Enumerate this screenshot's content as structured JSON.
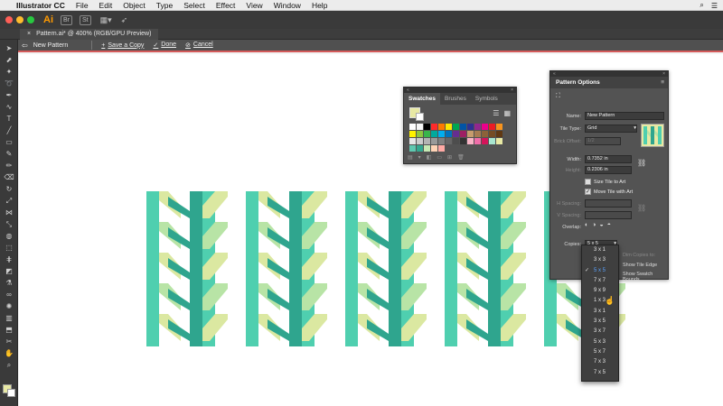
{
  "menubar": {
    "app": "Illustrator CC",
    "items": [
      "File",
      "Edit",
      "Object",
      "Type",
      "Select",
      "Effect",
      "View",
      "Window",
      "Help"
    ]
  },
  "appbar": {
    "logo": "Ai",
    "chips": [
      "Br",
      "St"
    ]
  },
  "document": {
    "tab_title": "Pattern.ai* @ 400% (RGB/GPU Preview)",
    "close": "×"
  },
  "pattern_bar": {
    "name": "New Pattern",
    "save_copy": "Save a Copy",
    "done": "Done",
    "cancel": "Cancel"
  },
  "swatches_panel": {
    "tabs": [
      "Swatches",
      "Brushes",
      "Symbols"
    ],
    "colors": [
      "#ffffff",
      "#f7f7f7",
      "#000000",
      "#ff2a2a",
      "#ff7a00",
      "#ffe600",
      "#00a651",
      "#0054a6",
      "#2e3192",
      "#92278f",
      "#ec008c",
      "#ed1c24",
      "#f7941d",
      "#fff200",
      "#8dc63f",
      "#39b54a",
      "#00a99d",
      "#00aeef",
      "#0072bc",
      "#662d91",
      "#9e1f63",
      "#c69c6d",
      "#a67c52",
      "#8c6239",
      "#754c24",
      "#603913",
      "#e6e6e6",
      "#cccccc",
      "#b3b3b3",
      "#999999",
      "#808080",
      "#666666",
      "#4d4d4d",
      "#333333",
      "#f9b4c6",
      "#f06ea9",
      "#d4145a",
      "#a8e6cf",
      "#e8e9a4",
      "#5ec8b0",
      "#33a88f",
      "#c7e9b4",
      "#ffd3b6",
      "#ffaaa5"
    ]
  },
  "pattern_options": {
    "title": "Pattern Options",
    "name_label": "Name:",
    "name_value": "New Pattern",
    "tile_type_label": "Tile Type:",
    "tile_type_value": "Grid",
    "brick_offset_label": "Brick Offset:",
    "brick_offset_value": "1/2",
    "width_label": "Width:",
    "width_value": "0.7352 in",
    "height_label": "Height:",
    "height_value": "0.2306 in",
    "size_tile_label": "Size Tile to Art",
    "move_tile_label": "Move Tile with Art",
    "h_spacing_label": "H Spacing:",
    "v_spacing_label": "V Spacing:",
    "overlap_label": "Overlap:",
    "copies_label": "Copies:",
    "copies_value": "5 x 5",
    "dim_copies_label": "Dim Copies to:",
    "show_edge_label": "Show Tile Edge",
    "show_bounds_label": "Show Swatch Bounds"
  },
  "copies_dropdown": {
    "options": [
      "3 x 1",
      "3 x 3",
      "5 x 5",
      "7 x 7",
      "9 x 9",
      "1 x 3",
      "3 x 1",
      "3 x 5",
      "3 x 7",
      "5 x 3",
      "5 x 7",
      "7 x 3",
      "7 x 5"
    ],
    "selected_index": 2
  },
  "toolbar": {
    "tools": [
      "selection-tool",
      "direct-selection-tool",
      "magic-wand-tool",
      "lasso-tool",
      "pen-tool",
      "curvature-tool",
      "type-tool",
      "line-tool",
      "rectangle-tool",
      "paintbrush-tool",
      "pencil-tool",
      "eraser-tool",
      "rotate-tool",
      "scale-tool",
      "width-tool",
      "free-transform-tool",
      "shape-builder-tool",
      "perspective-tool",
      "mesh-tool",
      "gradient-tool",
      "eyedropper-tool",
      "blend-tool",
      "symbol-sprayer-tool",
      "column-graph-tool",
      "artboard-tool",
      "slice-tool",
      "hand-tool",
      "zoom-tool"
    ]
  },
  "colors": {
    "teal_dark": "#2fa58e",
    "teal": "#4fcfaf",
    "yellow_green": "#dbe8a1",
    "light_green": "#b8e4a6"
  }
}
